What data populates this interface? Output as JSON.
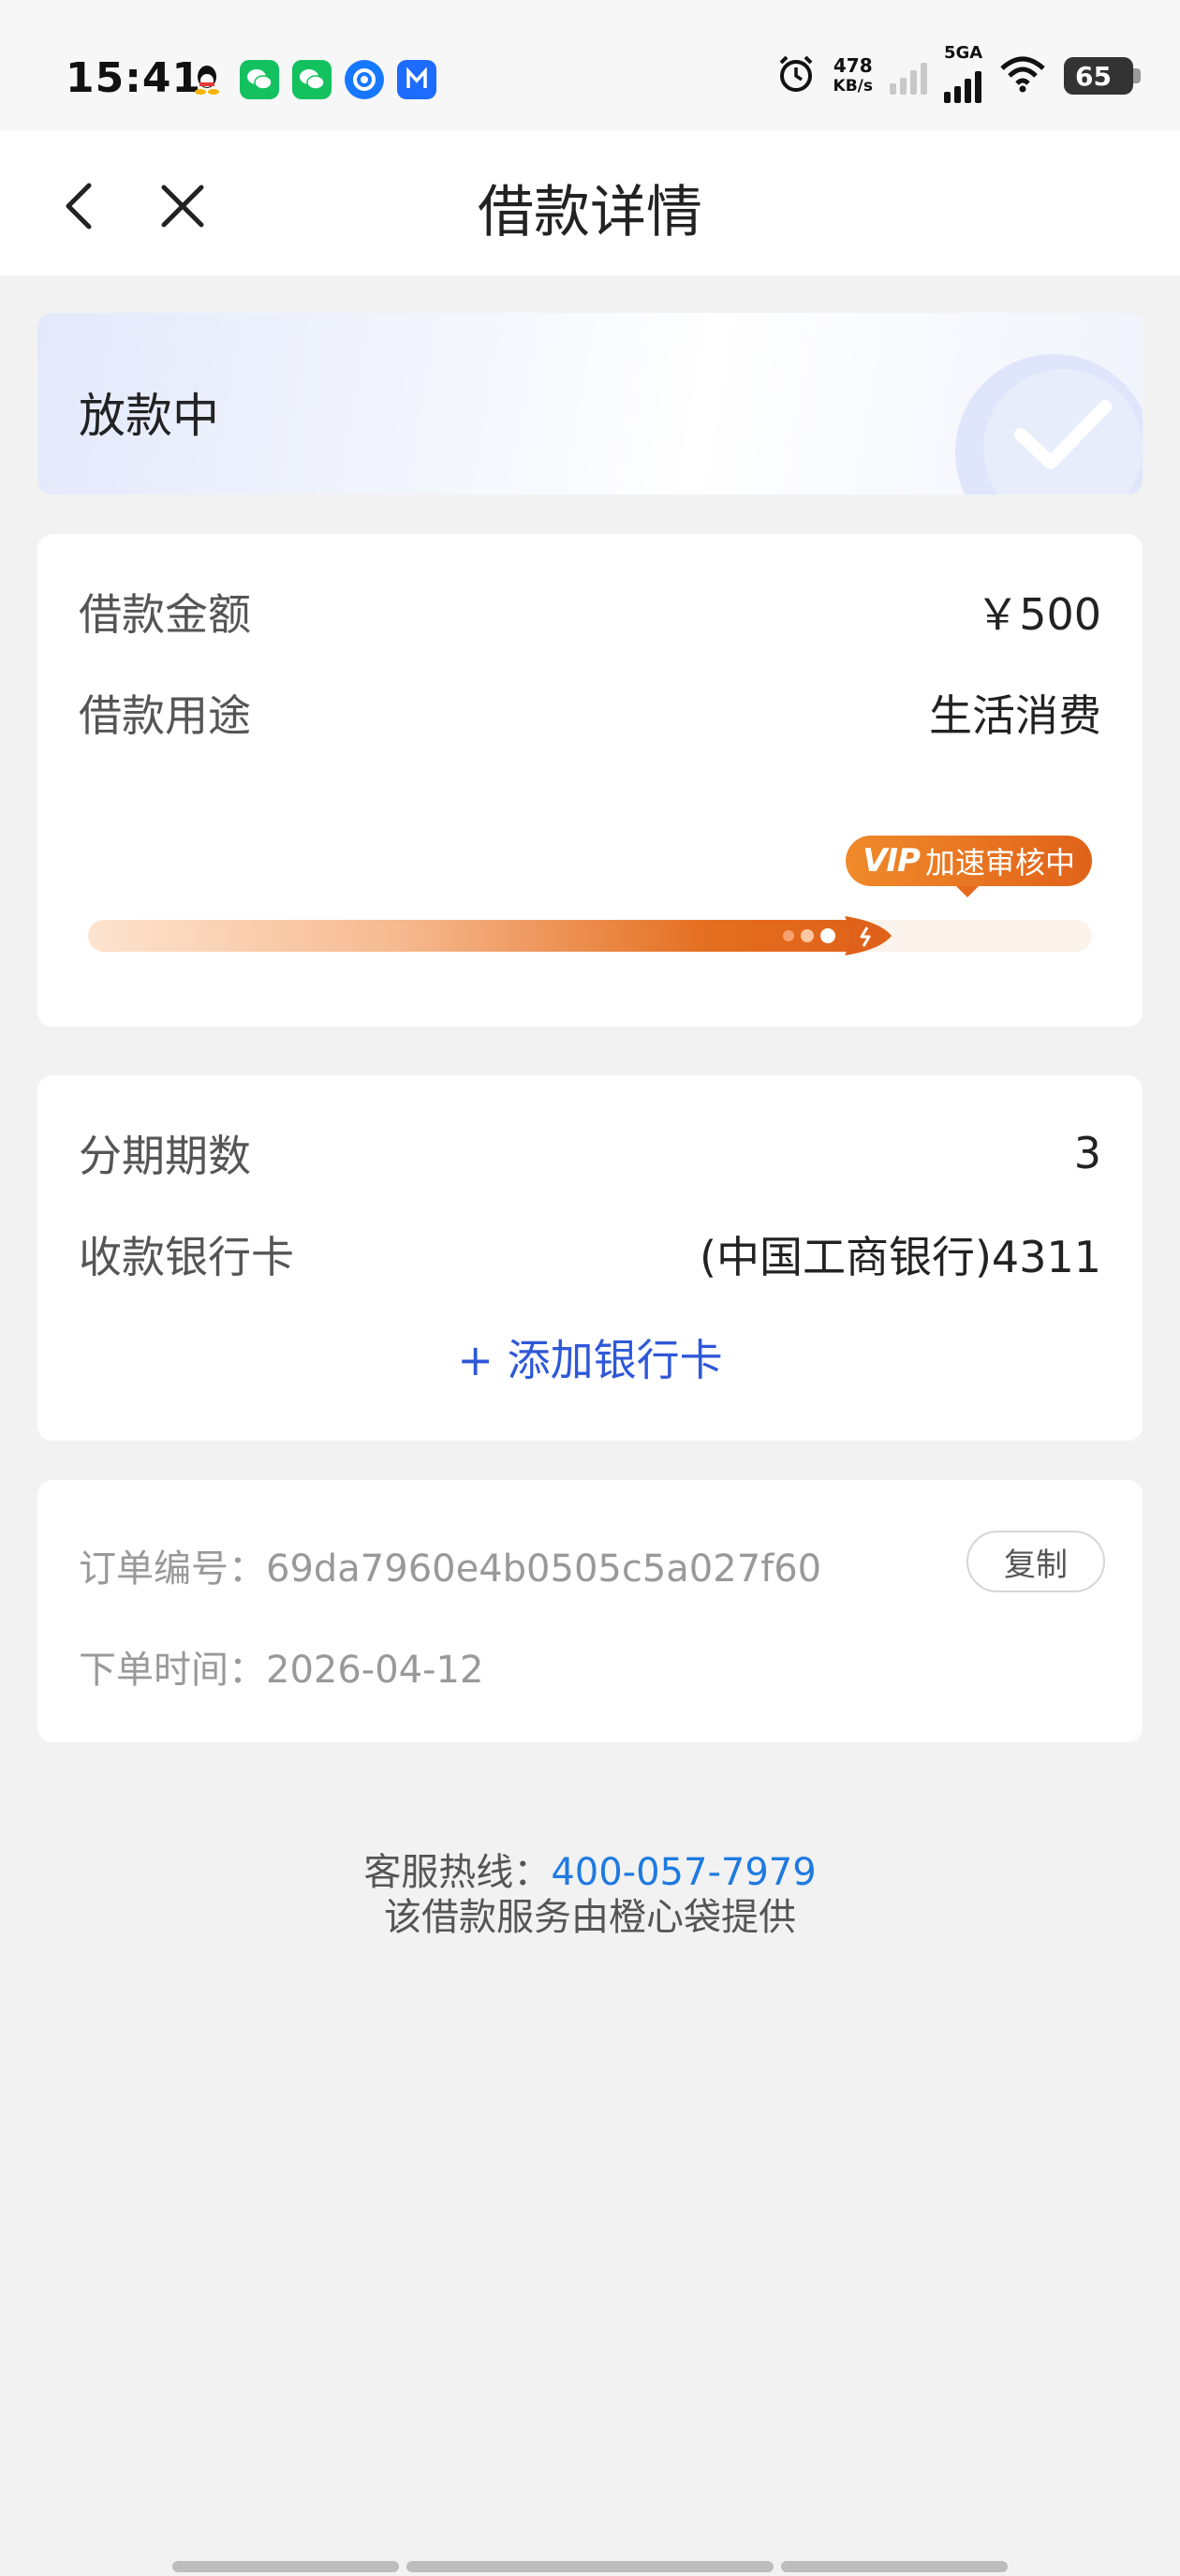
{
  "status_bar": {
    "time": "15:41",
    "net_speed_value": "478",
    "net_speed_unit": "KB/s",
    "network_type": "5GA",
    "battery": "65"
  },
  "header": {
    "title": "借款详情"
  },
  "loan_status": {
    "text": "放款中"
  },
  "loan": {
    "amount_label": "借款金额",
    "amount_value": "￥500",
    "purpose_label": "借款用途",
    "purpose_value": "生活消费",
    "vip_prefix": "VIP",
    "vip_text": "加速审核中",
    "progress": 0.78
  },
  "bank": {
    "installments_label": "分期期数",
    "installments_value": "3",
    "card_label": "收款银行卡",
    "card_value": "(中国工商银行)4311",
    "add_card": "+ 添加银行卡"
  },
  "order": {
    "number_text": "订单编号：69da7960e4b0505c5a027f60",
    "copy_label": "复制",
    "time_text": "下单时间：2026-04-12"
  },
  "footer": {
    "hotline_label": "客服热线：",
    "hotline_number": "400-057-7979",
    "provider": "该借款服务由橙心袋提供"
  }
}
